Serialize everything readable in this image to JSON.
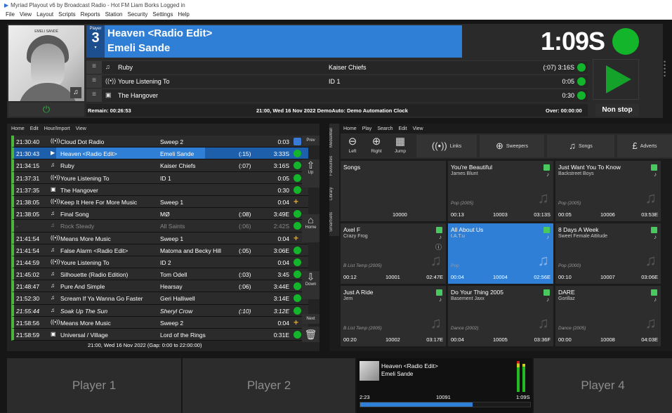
{
  "window": {
    "title": "Myriad Playout v6 by Broadcast Radio - Hot FM Liam Borks Logged in"
  },
  "menu": [
    "File",
    "View",
    "Layout",
    "Scripts",
    "Reports",
    "Station",
    "Security",
    "Settings",
    "Help"
  ],
  "player": {
    "label": "Player",
    "number": "3",
    "title": "Heaven <Radio Edit>",
    "artist": "Emeli Sande",
    "time": "1:09S",
    "art_brand": "EMELI SANDÉ",
    "next": [
      {
        "icon": "music-note-icon",
        "title": "Ruby",
        "artist": "Kaiser Chiefs",
        "duration": "(:07) 3:16S"
      },
      {
        "icon": "broadcast-icon",
        "title": "Youre Listening To",
        "artist": "ID 1",
        "duration": "0:05"
      },
      {
        "icon": "camera-icon",
        "title": "The Hangover",
        "artist": "",
        "duration": "0:30"
      }
    ],
    "status": {
      "remain": "Remain:  00:26:53",
      "mid": "21:00, Wed 16 Nov 2022  DemoAuto: Demo Automation Clock",
      "over": "Over:  00:00:00"
    },
    "nonstop": "Non stop"
  },
  "log": {
    "menu": [
      "Home",
      "Edit",
      "Hour/Import",
      "View"
    ],
    "rows": [
      {
        "time": "21:30:40",
        "icon": "broadcast-icon",
        "glyph": "((•))",
        "title": "Cloud Dot Radio",
        "artist": "Sweep 2",
        "intro": "",
        "duration": "0:03",
        "status": "check",
        "style": ""
      },
      {
        "time": "21:30:43",
        "icon": "play-icon",
        "glyph": "▶",
        "title": "Heaven <Radio Edit>",
        "artist": "Emeli Sande",
        "intro": "(:15)",
        "duration": "3:33S",
        "status": "dot",
        "style": "sel"
      },
      {
        "time": "21:34:15",
        "icon": "music-note-icon",
        "glyph": "♫",
        "title": "Ruby",
        "artist": "Kaiser Chiefs",
        "intro": "(:07)",
        "duration": "3:16S",
        "status": "dot",
        "style": ""
      },
      {
        "time": "21:37:31",
        "icon": "broadcast-icon",
        "glyph": "((•))",
        "title": "Youre Listening To",
        "artist": "ID 1",
        "intro": "",
        "duration": "0:05",
        "status": "dot",
        "style": ""
      },
      {
        "time": "21:37:35",
        "icon": "camera-icon",
        "glyph": "▣",
        "title": "The Hangover",
        "artist": "",
        "intro": "",
        "duration": "0:30",
        "status": "dot",
        "style": ""
      },
      {
        "time": "21:38:05",
        "icon": "broadcast-icon",
        "glyph": "((•))",
        "title": "Keep It Here For More Music",
        "artist": "Sweep 1",
        "intro": "",
        "duration": "0:04",
        "status": "plus",
        "style": ""
      },
      {
        "time": "21:38:05",
        "icon": "music-note-icon",
        "glyph": "♫",
        "title": "Final Song",
        "artist": "MØ",
        "intro": "(:08)",
        "duration": "3:49E",
        "status": "dot",
        "style": ""
      },
      {
        "time": "-",
        "icon": "music-note-icon",
        "glyph": "♫",
        "title": "Rock Steady",
        "artist": "All Saints",
        "intro": "(:06)",
        "duration": "2:42S",
        "status": "dot",
        "style": "gray"
      },
      {
        "time": "21:41:54",
        "icon": "broadcast-icon",
        "glyph": "((•))",
        "title": "Means More Music",
        "artist": "Sweep 1",
        "intro": "",
        "duration": "0:04",
        "status": "plus",
        "style": ""
      },
      {
        "time": "21:41:54",
        "icon": "music-note-icon",
        "glyph": "♫",
        "title": "False Alarm <Radio Edit>",
        "artist": "Matoma and Becky Hill",
        "intro": "(:05)",
        "duration": "3:06E",
        "status": "dot",
        "style": ""
      },
      {
        "time": "21:44:59",
        "icon": "broadcast-icon",
        "glyph": "((•))",
        "title": "Youre Listening To",
        "artist": "ID 2",
        "intro": "",
        "duration": "0:04",
        "status": "dot",
        "style": ""
      },
      {
        "time": "21:45:02",
        "icon": "music-note-icon",
        "glyph": "♫",
        "title": "Silhouette (Radio Edition)",
        "artist": "Tom Odell",
        "intro": "(:03)",
        "duration": "3:45",
        "status": "dot",
        "style": ""
      },
      {
        "time": "21:48:47",
        "icon": "music-note-icon",
        "glyph": "♫",
        "title": "Pure And Simple",
        "artist": "Hearsay",
        "intro": "(:06)",
        "duration": "3:44E",
        "status": "dot",
        "style": ""
      },
      {
        "time": "21:52:30",
        "icon": "music-note-icon",
        "glyph": "♫",
        "title": "Scream If Ya Wanna Go Faster",
        "artist": "Geri Halliwell",
        "intro": "",
        "duration": "3:14E",
        "status": "dot",
        "style": ""
      },
      {
        "time": "21:55:44",
        "icon": "music-note-icon",
        "glyph": "♫",
        "title": "Soak Up The Sun",
        "artist": "Sheryl Crow",
        "intro": "(:10)",
        "duration": "3:12E",
        "status": "dot",
        "style": "it"
      },
      {
        "time": "21:58:56",
        "icon": "broadcast-icon",
        "glyph": "((•))",
        "title": "Means More Music",
        "artist": "Sweep 2",
        "intro": "",
        "duration": "0:04",
        "status": "plus",
        "style": ""
      },
      {
        "time": "21:58:59",
        "icon": "camera-icon",
        "glyph": "▣",
        "title": "Universal / Village",
        "artist": "Lord of the Rings",
        "intro": "",
        "duration": "0:31E",
        "status": "dot",
        "style": ""
      }
    ],
    "footer": "21:00, Wed 16 Nov 2022 (Gap: 0:00 to 22:00:00)",
    "side": {
      "prev": "Prev",
      "up": "Up",
      "home": "Home",
      "down": "Down",
      "next": "Next"
    }
  },
  "mediawall": {
    "tabs": [
      "MediaWall",
      "Favourites",
      "Library",
      "SmartSets"
    ],
    "menu": [
      "Home",
      "Play",
      "Search",
      "Edit",
      "View"
    ],
    "nav": {
      "left": "Left",
      "right": "Right",
      "jump": "Jump"
    },
    "categories": [
      {
        "icon": "broadcast-icon",
        "label": "Links"
      },
      {
        "icon": "plus-circle-icon",
        "label": "Sweepers"
      },
      {
        "icon": "music-note-icon",
        "label": "Songs"
      },
      {
        "icon": "pound-icon",
        "label": "Adverts"
      }
    ],
    "cards": [
      {
        "title": "Songs",
        "artist": "",
        "genre": "",
        "intro": "",
        "id": "10000",
        "dur": "",
        "kind": "header"
      },
      {
        "title": "You're Beautiful",
        "artist": "James Blunt",
        "genre": "Pop (2005)",
        "intro": "00:13",
        "id": "10003",
        "dur": "03:13S",
        "kind": "song"
      },
      {
        "title": "Just Want You To Know",
        "artist": "Backstreet Boys",
        "genre": "Pop (2005)",
        "intro": "00:05",
        "id": "10006",
        "dur": "03:53E",
        "kind": "song"
      },
      {
        "title": "Axel F",
        "artist": "Crazy Frog",
        "genre": "B List Temp (2005)",
        "intro": "00:12",
        "id": "10001",
        "dur": "02:47E",
        "kind": "song",
        "info": true
      },
      {
        "title": "All About Us",
        "artist": "t.A.T.u",
        "genre": "Pop",
        "intro": "00:04",
        "id": "10004",
        "dur": "02:56E",
        "kind": "song",
        "sel": true
      },
      {
        "title": "8 Days A Week",
        "artist": "Sweet Female Attitude",
        "genre": "Pop (2000)",
        "intro": "00:10",
        "id": "10007",
        "dur": "03:06E",
        "kind": "song"
      },
      {
        "title": "Just A Ride",
        "artist": "Jem",
        "genre": "B List Temp (2005)",
        "intro": "00:20",
        "id": "10002",
        "dur": "03:17E",
        "kind": "song"
      },
      {
        "title": "Do Your Thing 2005",
        "artist": "Basement Jaxx",
        "genre": "Dance (2002)",
        "intro": "00:04",
        "id": "10005",
        "dur": "03:36F",
        "kind": "song"
      },
      {
        "title": "DARE",
        "artist": "Gorillaz",
        "genre": "Dance (2005)",
        "intro": "00:00",
        "id": "10008",
        "dur": "04:03E",
        "kind": "song"
      }
    ]
  },
  "bottom": {
    "player1": "Player 1",
    "player2": "Player 2",
    "player4": "Player 4",
    "mini": {
      "title": "Heaven <Radio Edit>",
      "artist": "Emeli Sande",
      "elapsed": "2:23",
      "id": "10091",
      "remain": "1:09S",
      "progress": 0.66
    }
  }
}
